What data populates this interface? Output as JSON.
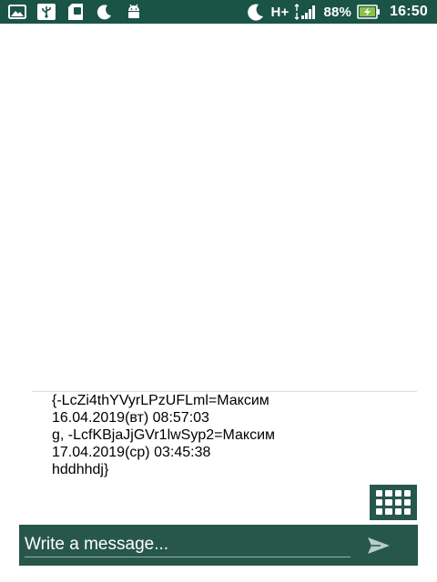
{
  "status_bar": {
    "left_icons": [
      "image-icon",
      "usb-icon",
      "sd-card-icon",
      "moon-icon",
      "android-icon"
    ],
    "right_icons": [
      "moon-icon",
      "signal-icon",
      "battery-charging-icon"
    ],
    "network": "H+",
    "battery": "88%",
    "time": "16:50"
  },
  "chat": {
    "message_lines": [
      "{-LcZi4thYVyrLPzUFLml=Максим",
      "16.04.2019(вт) 08:57:03",
      "g, -LcfKBjaJjGVr1lwSyp2=Максим",
      "17.04.2019(ср) 03:45:38",
      "hddhhdj}"
    ]
  },
  "input": {
    "placeholder": "Write a message...",
    "value": ""
  },
  "buttons": {
    "keyboard_icon": "keyboard-grid-icon",
    "send_icon": "send-icon"
  },
  "colors": {
    "status_bar": "#1a5446",
    "accent": "#27574a",
    "text": "#000000"
  }
}
